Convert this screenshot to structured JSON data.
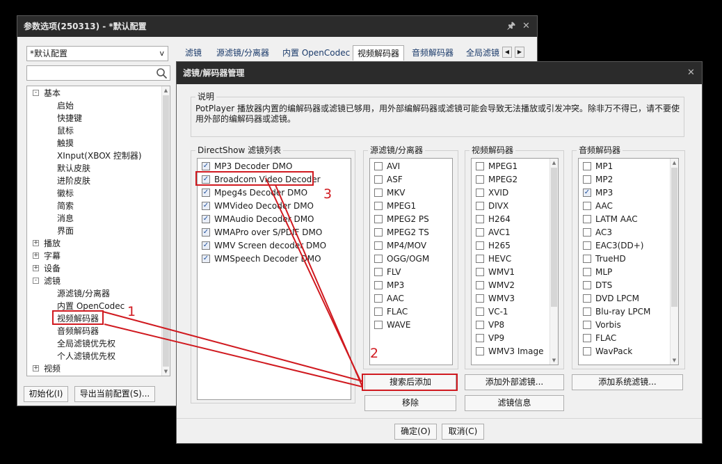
{
  "back_window": {
    "title": "参数选项(250313) - *默认配置",
    "pin_icon": "pin-icon",
    "close_icon": "close-icon",
    "profile_select": "*默认配置",
    "search_value": "",
    "tree": [
      {
        "label": "基本",
        "level": 0,
        "toggle": "-"
      },
      {
        "label": "启始",
        "level": 1
      },
      {
        "label": "快捷键",
        "level": 1
      },
      {
        "label": "鼠标",
        "level": 1
      },
      {
        "label": "触摸",
        "level": 1
      },
      {
        "label": "XInput(XBOX 控制器)",
        "level": 1
      },
      {
        "label": "默认皮肤",
        "level": 1
      },
      {
        "label": "进阶皮肤",
        "level": 1
      },
      {
        "label": "徽标",
        "level": 1
      },
      {
        "label": "简索",
        "level": 1
      },
      {
        "label": "消息",
        "level": 1
      },
      {
        "label": "界面",
        "level": 1
      },
      {
        "label": "播放",
        "level": 0,
        "toggle": "+"
      },
      {
        "label": "字幕",
        "level": 0,
        "toggle": "+"
      },
      {
        "label": "设备",
        "level": 0,
        "toggle": "+"
      },
      {
        "label": "滤镜",
        "level": 0,
        "toggle": "-"
      },
      {
        "label": "源滤镜/分离器",
        "level": 1
      },
      {
        "label": "内置 OpenCodec",
        "level": 1
      },
      {
        "label": "视频解码器",
        "level": 1
      },
      {
        "label": "音频解码器",
        "level": 1
      },
      {
        "label": "全局滤镜优先权",
        "level": 1
      },
      {
        "label": "个人滤镜优先权",
        "level": 1
      },
      {
        "label": "视频",
        "level": 0,
        "toggle": "+"
      }
    ],
    "tabs": [
      "滤镜",
      "源滤镜/分离器",
      "内置 OpenCodec",
      "视频解码器",
      "音频解码器",
      "全局滤镜"
    ],
    "selected_tab": "视频解码器",
    "buttons": {
      "init": "初始化(I)",
      "export": "导出当前配置(S)..."
    }
  },
  "dialog": {
    "title": "滤镜/解码器管理",
    "desc_label": "说明",
    "desc_text_1": "PotPlayer 播放器内置的编解码器或滤镜已够用，用外部编解码器或滤镜可能会导致无法播放或引发冲突。除非万不得已，请不要使",
    "desc_text_2": "用外部的编解码器或滤镜。",
    "directshow": {
      "label": "DirectShow 滤镜列表",
      "items": [
        {
          "label": "MP3 Decoder DMO",
          "checked": true
        },
        {
          "label": "Broadcom Video Decoder",
          "checked": true
        },
        {
          "label": "Mpeg4s Decoder DMO",
          "checked": true
        },
        {
          "label": "WMVideo Decoder DMO",
          "checked": true
        },
        {
          "label": "WMAudio Decoder DMO",
          "checked": true
        },
        {
          "label": "WMAPro over S/PDIF DMO",
          "checked": true
        },
        {
          "label": "WMV Screen decoder DMO",
          "checked": true
        },
        {
          "label": "WMSpeech Decoder DMO",
          "checked": true
        }
      ]
    },
    "source": {
      "label": "源滤镜/分离器",
      "items": [
        {
          "label": "AVI",
          "checked": false
        },
        {
          "label": "ASF",
          "checked": false
        },
        {
          "label": "MKV",
          "checked": false
        },
        {
          "label": "MPEG1",
          "checked": false
        },
        {
          "label": "MPEG2 PS",
          "checked": false
        },
        {
          "label": "MPEG2 TS",
          "checked": false
        },
        {
          "label": "MP4/MOV",
          "checked": false
        },
        {
          "label": "OGG/OGM",
          "checked": false
        },
        {
          "label": "FLV",
          "checked": false
        },
        {
          "label": "MP3",
          "checked": false
        },
        {
          "label": "AAC",
          "checked": false
        },
        {
          "label": "FLAC",
          "checked": false
        },
        {
          "label": "WAVE",
          "checked": false
        }
      ]
    },
    "video": {
      "label": "视频解码器",
      "items": [
        {
          "label": "MPEG1",
          "checked": false
        },
        {
          "label": "MPEG2",
          "checked": false
        },
        {
          "label": "XVID",
          "checked": false
        },
        {
          "label": "DIVX",
          "checked": false
        },
        {
          "label": "H264",
          "checked": false
        },
        {
          "label": "AVC1",
          "checked": false
        },
        {
          "label": "H265",
          "checked": false
        },
        {
          "label": "HEVC",
          "checked": false
        },
        {
          "label": "WMV1",
          "checked": false
        },
        {
          "label": "WMV2",
          "checked": false
        },
        {
          "label": "WMV3",
          "checked": false
        },
        {
          "label": "VC-1",
          "checked": false
        },
        {
          "label": "VP8",
          "checked": false
        },
        {
          "label": "VP9",
          "checked": false
        },
        {
          "label": "WMV3 Image",
          "checked": false
        }
      ]
    },
    "audio": {
      "label": "音频解码器",
      "items": [
        {
          "label": "MP1",
          "checked": false
        },
        {
          "label": "MP2",
          "checked": false
        },
        {
          "label": "MP3",
          "checked": true
        },
        {
          "label": "AAC",
          "checked": false
        },
        {
          "label": "LATM AAC",
          "checked": false
        },
        {
          "label": "AC3",
          "checked": false
        },
        {
          "label": "EAC3(DD+)",
          "checked": false
        },
        {
          "label": "TrueHD",
          "checked": false
        },
        {
          "label": "MLP",
          "checked": false
        },
        {
          "label": "DTS",
          "checked": false
        },
        {
          "label": "DVD LPCM",
          "checked": false
        },
        {
          "label": "Blu-ray LPCM",
          "checked": false
        },
        {
          "label": "Vorbis",
          "checked": false
        },
        {
          "label": "FLAC",
          "checked": false
        },
        {
          "label": "WavPack",
          "checked": false
        }
      ]
    },
    "buttons": {
      "search_add": "搜索后添加",
      "remove": "移除",
      "add_external": "添加外部滤镜...",
      "filter_info": "滤镜信息",
      "add_system": "添加系统滤镜...",
      "ok": "确定(O)",
      "cancel": "取消(C)"
    }
  },
  "annotations": {
    "n1": "1",
    "n2": "2",
    "n3": "3",
    "color": "#d0191f"
  }
}
